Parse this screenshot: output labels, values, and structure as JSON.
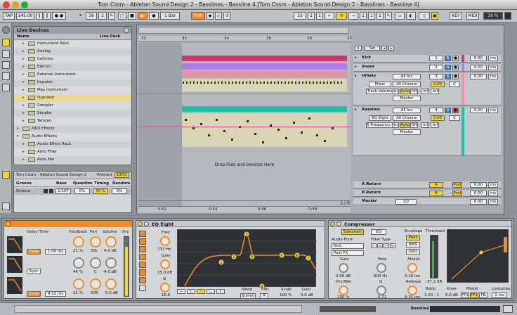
{
  "window": {
    "title": "Tom Cosm - Ableton Sound Design 2 - Basslines - Bassline 4  [Tom Cosm - Ableton Sound Design 2 - Basslines - Bassline 4]"
  },
  "toolbar": {
    "tap": "TAP",
    "tempo": "145.00",
    "time_sig_num": "36",
    "time_sig_den": "2",
    "quantize": "1 Bar",
    "ovr": "OVR",
    "pos1": "33",
    "pos2": "1",
    "pos3": "1",
    "key": "KEY",
    "midi": "MIDI",
    "cpu": "16 %"
  },
  "browser": {
    "header": "Live Devices",
    "col_name": "Name",
    "col_pack": "Live Pack",
    "items": [
      "Instrument Rack",
      "Analog",
      "Collision",
      "Electric",
      "External Instrument",
      "Impulse",
      "Max Instrument",
      "Operator",
      "Sampler",
      "Simpler",
      "Tension",
      "MIDI Effects",
      "Audio Effects",
      "Audio Effect Rack",
      "Auto Filter",
      "Auto Pan"
    ]
  },
  "groove": {
    "title": "Tom Cosm - Ableton Sound Design 2 -",
    "amount_label": "Amount",
    "amount": "100%",
    "cols": [
      "Groove",
      "Base",
      "Quantize",
      "Timing",
      "Random"
    ],
    "name": "Groove",
    "base": "1/16T",
    "quantize": "0%",
    "timing": "70 %",
    "random": "0%"
  },
  "arrangement": {
    "bar_marks": [
      "32",
      "33",
      "34",
      "35",
      "36",
      "37"
    ],
    "time_marks": [
      "0:52",
      "0:54",
      "0:56",
      "0:58"
    ],
    "drop_text": "Drop Files and Devices Here",
    "loop": "1/4",
    "set_label": "Set"
  },
  "tracks": [
    {
      "name": "Kick",
      "num": "1",
      "vol": "0.00",
      "unit": "ms"
    },
    {
      "name": "Snare",
      "num": "2",
      "vol": "0.00",
      "unit": "ms"
    },
    {
      "name": "Hihats",
      "num": "3",
      "input": "All Ins",
      "mixer": "Mixer",
      "channel": "All Channe",
      "track_vol": "Track Volume",
      "in": "In",
      "auto": "Auto",
      "off": "Off",
      "m1": "-inf",
      "m2": "-inf",
      "master": "Master",
      "pan": "C",
      "db": "0.00",
      "send": "0.00",
      "unit": "ms"
    },
    {
      "name": "Bassline",
      "num": "4",
      "input": "All Ins",
      "eq": "EQ Eight",
      "channel": "All Channe",
      "freq": "6 Frequency A",
      "in": "In",
      "auto": "Auto",
      "off": "Off",
      "m1": "-inf",
      "m2": "-inf",
      "master": "Master",
      "pan": "C",
      "db": "0.00",
      "send": "0.00",
      "unit": "ms"
    }
  ],
  "returns": [
    {
      "name": "A Return",
      "letter": "A",
      "post": "Post",
      "vol": "0.00",
      "unit": "ms"
    },
    {
      "name": "B Return",
      "letter": "B",
      "post": "Post",
      "vol": "0.00",
      "unit": "ms"
    },
    {
      "name": "Master",
      "quant": "1/2",
      "vol": "0.00",
      "unit": "ms"
    }
  ],
  "delay": {
    "labels": [
      "Delay Time",
      "Feedback",
      "Pan",
      "Volume",
      "Dry"
    ],
    "time_btn": "Time",
    "sync_btn": "Sync",
    "time1": "1.00 ms",
    "fb1": "21 %",
    "pan1": "50L",
    "vol1": "4.0 dB",
    "fb2": "46 %",
    "pan2": "C",
    "vol2": "-4.0 dB",
    "time3": "4.12 ms",
    "fb3": "21 %",
    "pan3": "50R",
    "vol3": "-5.0 dB"
  },
  "eq": {
    "title": "EQ Eight",
    "freq_label": "Freq",
    "freq": "732 Hz",
    "gain_label": "Gain",
    "gain": "15.0 dB",
    "q_label": "Q",
    "q": "16.6",
    "mode_label": "Mode",
    "mode": "Stereo",
    "edit_label": "Edit",
    "edit": "A",
    "scale_label": "Scale",
    "scale": "100 %",
    "gain2_label": "Gain",
    "gain2": "0.0 dB",
    "band_points": [
      "1",
      "2",
      "3",
      "4",
      "5",
      "6",
      "7",
      "8"
    ]
  },
  "compressor": {
    "title": "Compressor",
    "sidechain": "Sidechain",
    "eq_btn": "EQ",
    "audio_from": "Audio From",
    "source": "Kick",
    "post_fx": "Post FX",
    "filter_type": "Filter Type",
    "gain_label": "Gain",
    "gain": "0.00 dB",
    "freq_label": "Freq",
    "freq": "800 Hz",
    "drywet_label": "Dry/Wet",
    "drywet": "100 %",
    "q_label": "Q",
    "q": "0.71",
    "envelope": "Envelope",
    "peak": "Peak",
    "rms": "RMS",
    "opto": "Opto",
    "attack_label": "Attack",
    "attack": "0.16 ms",
    "release_label": "Release",
    "release": "6.31 ms",
    "threshold_label": "Threshold",
    "threshold": "-37.2 dB",
    "ratio_label": "Ratio",
    "ratio": "1.00 : 1",
    "knee_label": "Knee",
    "knee": "6.0 dB",
    "model_label": "Model",
    "ff1": "FF1",
    "ff2": "FF2",
    "fb": "FB",
    "lookahead_label": "Lookahea",
    "lookahead": "1 ms"
  },
  "statusbar": {
    "track": "Bassline"
  }
}
